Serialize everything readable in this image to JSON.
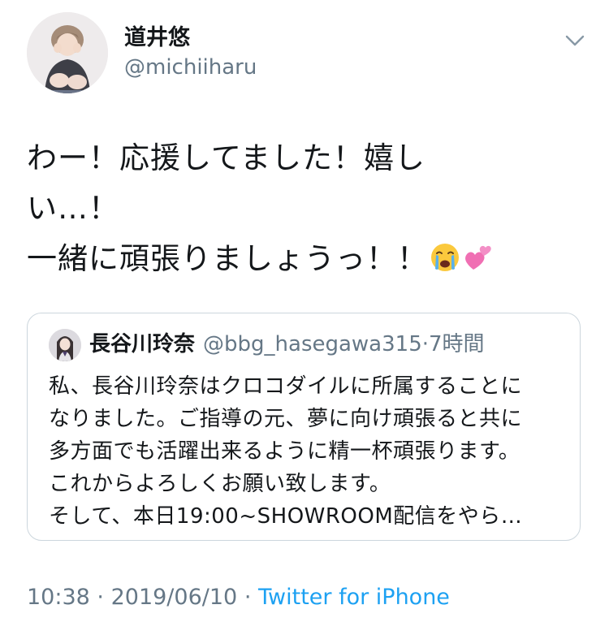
{
  "author": {
    "display_name": "道井悠",
    "handle": "@michiiharu"
  },
  "tweet": {
    "lines": [
      "わー！応援してました！嬉し",
      "い…！",
      "一緒に頑張りましょうっ！！"
    ],
    "emojis": [
      "crying-face-emoji",
      "two-hearts-emoji"
    ]
  },
  "quoted": {
    "display_name": "長谷川玲奈",
    "handle": "@bbg_hasegawa315",
    "separator": "·",
    "time": "7時間",
    "lines": [
      "私、長谷川玲奈はクロコダイルに所属することに",
      "なりました。ご指導の元、夢に向け頑張ると共に",
      "多方面でも活躍出来るように精一杯頑張ります。",
      "これからよろしくお願い致します。",
      "そして、本日19:00~SHOWROOM配信をやら…"
    ]
  },
  "meta": {
    "time": "10:38",
    "separator": "·",
    "date": "2019/06/10",
    "source": "Twitter for iPhone"
  },
  "colors": {
    "text": "#14171a",
    "secondary": "#657786",
    "link": "#1da1f2",
    "border": "#ccd6dd"
  }
}
